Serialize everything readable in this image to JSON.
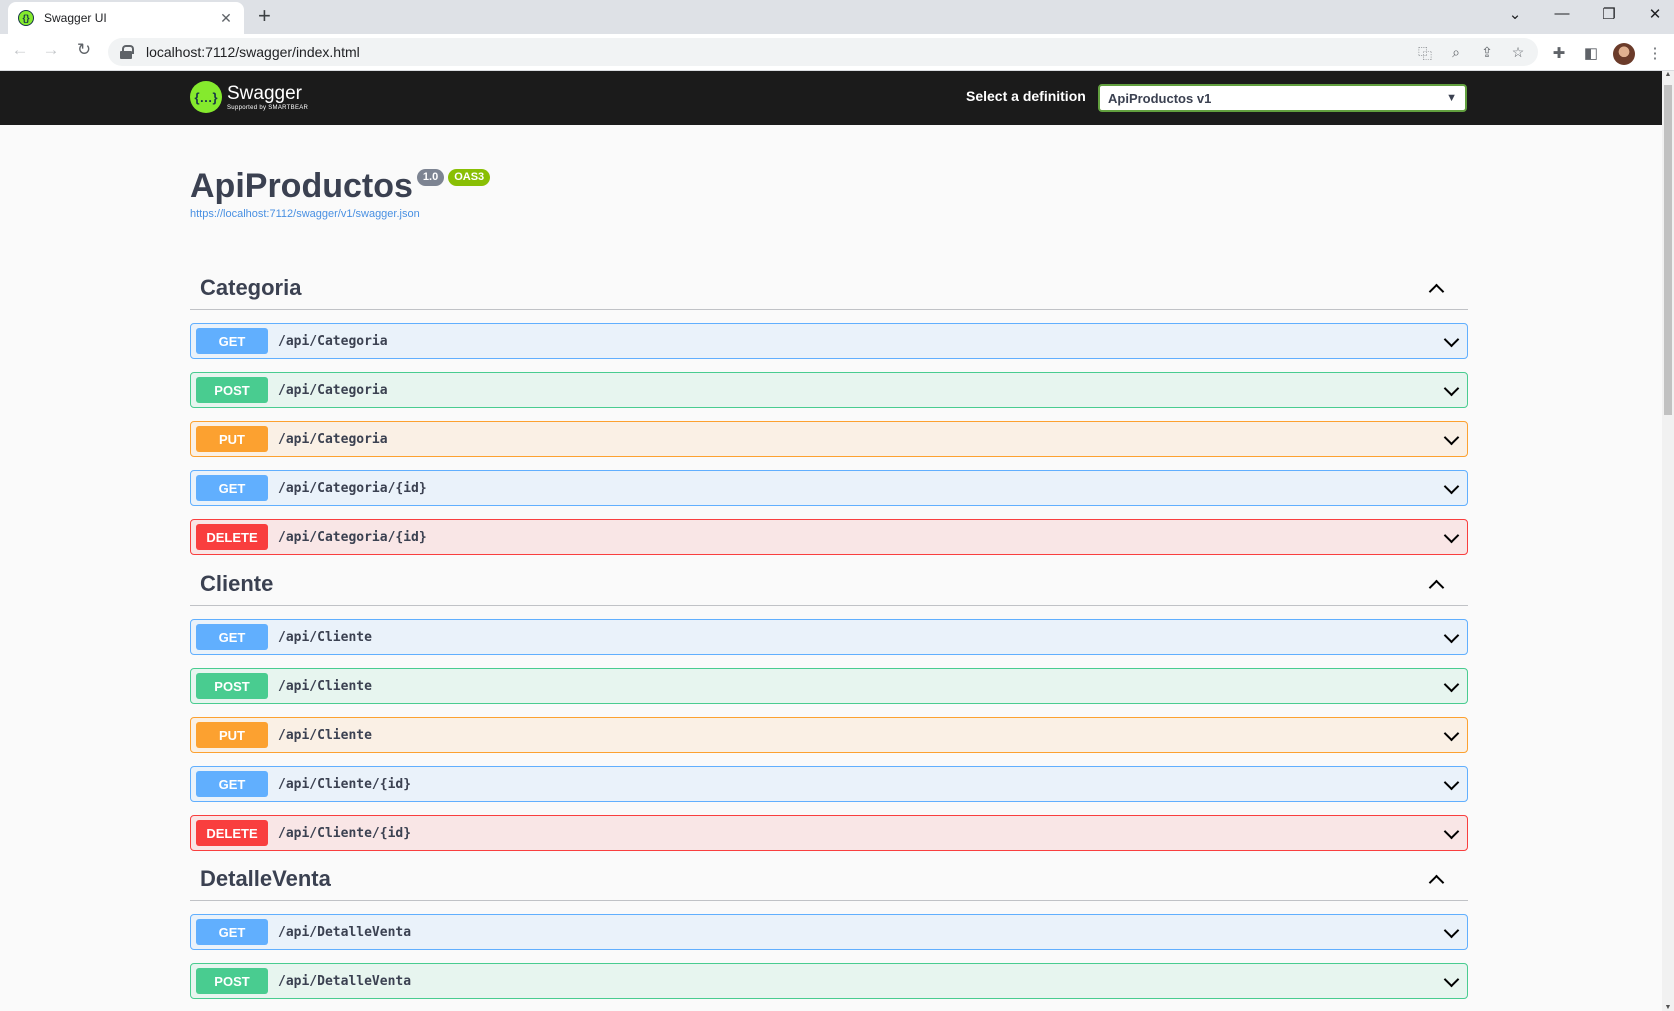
{
  "browser": {
    "tab_title": "Swagger UI",
    "tab_favicon": "swagger-icon",
    "url": "localhost:7112/swagger/index.html"
  },
  "topbar": {
    "logo_name": "Swagger",
    "logo_sub": "Supported by SMARTBEAR",
    "definition_label": "Select a definition",
    "definition_value": "ApiProductos v1"
  },
  "info": {
    "title": "ApiProductos",
    "version": "1.0",
    "oas": "OAS3",
    "spec_url": "https://localhost:7112/swagger/v1/swagger.json"
  },
  "tags": [
    {
      "name": "Categoria",
      "ops": [
        {
          "method": "GET",
          "path": "/api/Categoria"
        },
        {
          "method": "POST",
          "path": "/api/Categoria"
        },
        {
          "method": "PUT",
          "path": "/api/Categoria"
        },
        {
          "method": "GET",
          "path": "/api/Categoria/{id}"
        },
        {
          "method": "DELETE",
          "path": "/api/Categoria/{id}"
        }
      ]
    },
    {
      "name": "Cliente",
      "ops": [
        {
          "method": "GET",
          "path": "/api/Cliente"
        },
        {
          "method": "POST",
          "path": "/api/Cliente"
        },
        {
          "method": "PUT",
          "path": "/api/Cliente"
        },
        {
          "method": "GET",
          "path": "/api/Cliente/{id}"
        },
        {
          "method": "DELETE",
          "path": "/api/Cliente/{id}"
        }
      ]
    },
    {
      "name": "DetalleVenta",
      "ops": [
        {
          "method": "GET",
          "path": "/api/DetalleVenta"
        },
        {
          "method": "POST",
          "path": "/api/DetalleVenta"
        }
      ]
    }
  ],
  "colors": {
    "get": "#61affe",
    "post": "#49cc90",
    "put": "#fca130",
    "delete": "#f93e3e",
    "topbar": "#1b1b1b",
    "swagger_green": "#85ea2d"
  }
}
